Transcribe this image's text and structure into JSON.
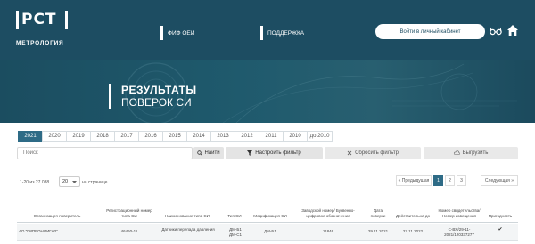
{
  "header": {
    "logo": {
      "mark": "РСТ",
      "subtitle": "МЕТРОЛОГИЯ"
    },
    "nav": [
      {
        "label": "ФИФ ОЕИ"
      },
      {
        "label": "ПОДДЕРЖКА"
      }
    ],
    "cabinet_button": "Войти в личный кабинет",
    "icons": [
      "glasses-icon",
      "home-icon"
    ]
  },
  "hero": {
    "title_line1": "РЕЗУЛЬТАТЫ",
    "title_line2": "ПОВЕРОК СИ"
  },
  "years": {
    "items": [
      "2021",
      "2020",
      "2019",
      "2018",
      "2017",
      "2016",
      "2015",
      "2014",
      "2013",
      "2012",
      "2011",
      "2010",
      "до 2010"
    ],
    "active": "2021"
  },
  "search": {
    "placeholder": "Поиск",
    "search_button": "Найти",
    "filter_button": "Настроить фильтр",
    "reset_button": "Сбросить фильтр",
    "export_button": "Выгрузить"
  },
  "pagination": {
    "range_text": "1-20 из 27 038",
    "per_page": "20",
    "per_page_label": "на странице",
    "prev_label": "« Предыдущая",
    "pages": [
      "1",
      "2",
      "3"
    ],
    "active_page": "1",
    "next_label": "Следующая »"
  },
  "table": {
    "columns": [
      "Организация-поверитель",
      "Регистрационный номер типа СИ",
      "Наименование типа СИ",
      "Тип СИ",
      "Модификация СИ",
      "Заводской номер/ Буквенно-цифровое обозначение",
      "Дата поверки",
      "Действительна до",
      "Номер свидетельства/ Номер извещения",
      "Пригодность"
    ],
    "rows": [
      {
        "org": "АО \"ГИПРОНИИГАЗ\"",
        "reg_number": "46460-11",
        "type_name": "Датчики перепада давления",
        "type_si": "ДМ-Б1 ДМ-С1",
        "modification": "ДМ-Б1",
        "serial": "11846",
        "verify_date": "29.11.2021",
        "valid_until": "27.11.2022",
        "certificate": "С-ВЯ/29-11-2021/120337277",
        "suitable": "✔"
      }
    ]
  },
  "colors": {
    "header_bg": "#1d4d62",
    "accent": "#2e6b86"
  }
}
